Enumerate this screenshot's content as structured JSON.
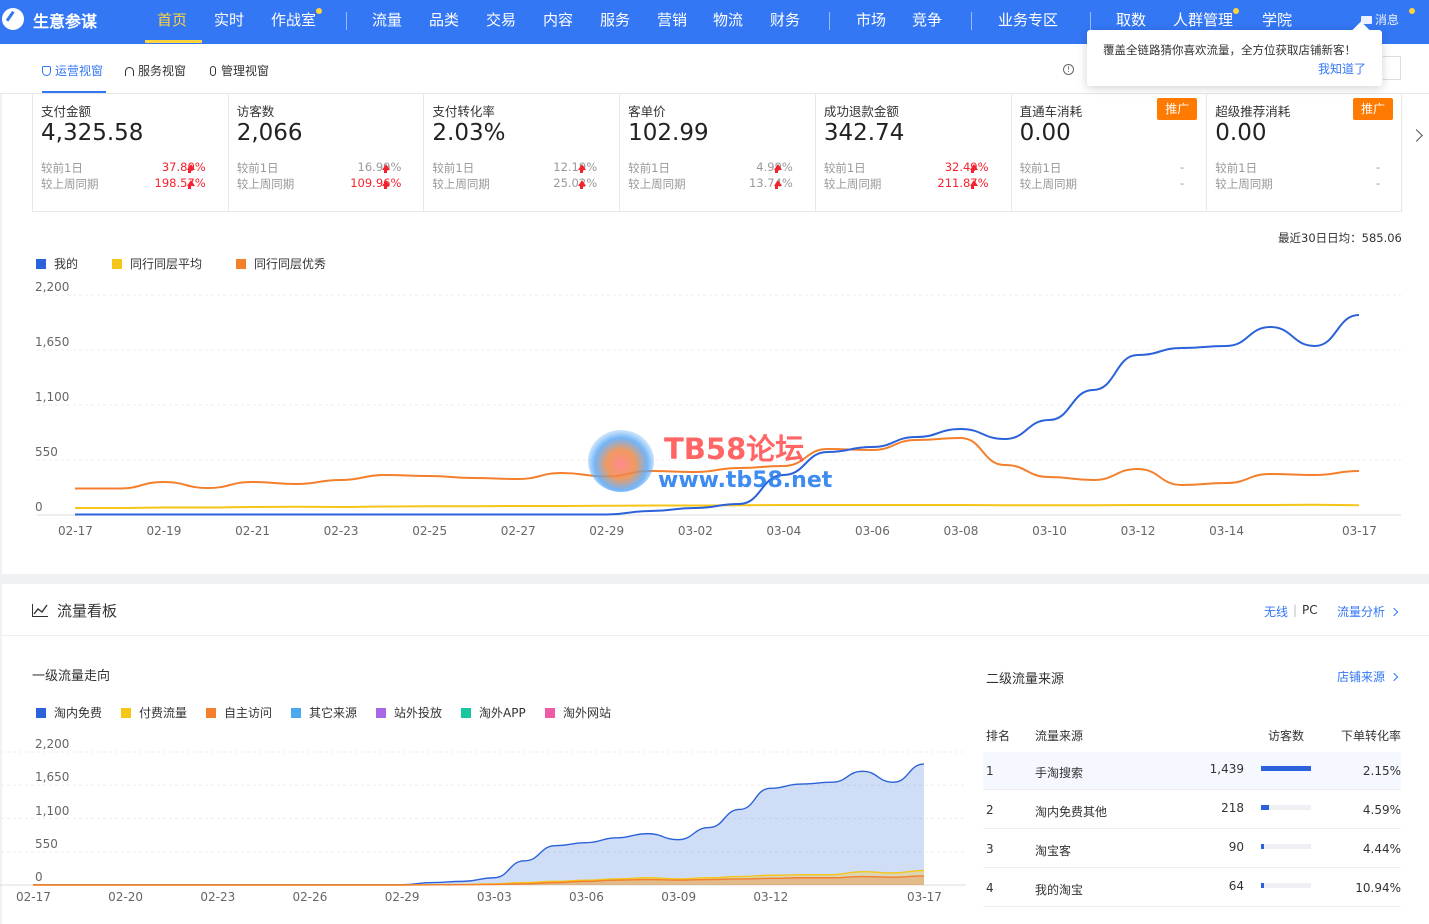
{
  "topnav": {
    "brand": "生意参谋",
    "items": [
      "首页",
      "实时",
      "作战室",
      "流量",
      "品类",
      "交易",
      "内容",
      "服务",
      "营销",
      "物流",
      "财务",
      "市场",
      "竞争",
      "业务专区",
      "取数",
      "人群管理",
      "学院"
    ],
    "message": "消息",
    "accent": "#3477f5",
    "active_color": "#ffd33d"
  },
  "tooltip": {
    "text": "覆盖全链路猜你喜欢流量，全方位获取店铺新客！",
    "link": "我知道了"
  },
  "subtabs": [
    "运营视窗",
    "服务视窗",
    "管理视窗"
  ],
  "kpis": [
    {
      "label": "支付金额",
      "value": "4,325.58",
      "cmp1_label": "较前1日",
      "cmp1": "37.80%",
      "cmp2_label": "较上周同期",
      "cmp2": "198.57%",
      "color": "red"
    },
    {
      "label": "访客数",
      "value": "2,066",
      "cmp1_label": "较前1日",
      "cmp1": "16.99%",
      "cmp2_label": "较上周同期",
      "cmp2": "109.96%",
      "color": "mixed"
    },
    {
      "label": "支付转化率",
      "value": "2.03%",
      "cmp1_label": "较前1日",
      "cmp1": "12.19%",
      "cmp2_label": "较上周同期",
      "cmp2": "25.02%",
      "color": "gray"
    },
    {
      "label": "客单价",
      "value": "102.99",
      "cmp1_label": "较前1日",
      "cmp1": "4.99%",
      "cmp2_label": "较上周同期",
      "cmp2": "13.74%",
      "color": "gray"
    },
    {
      "label": "成功退款金额",
      "value": "342.74",
      "cmp1_label": "较前1日",
      "cmp1": "32.49%",
      "cmp2_label": "较上周同期",
      "cmp2": "211.87%",
      "color": "red"
    },
    {
      "label": "直通车消耗",
      "value": "0.00",
      "cmp1_label": "较前1日",
      "cmp1": "-",
      "cmp2_label": "较上周同期",
      "cmp2": "-",
      "color": "none",
      "promo": "推广"
    },
    {
      "label": "超级推荐消耗",
      "value": "0.00",
      "cmp1_label": "较前1日",
      "cmp1": "-",
      "cmp2_label": "较上周同期",
      "cmp2": "-",
      "color": "none",
      "promo": "推广"
    }
  ],
  "avg_note": "最近30日日均：585.06",
  "watermark": {
    "title": "TB58论坛",
    "url": "www.tb58.net"
  },
  "traffic": {
    "title": "流量看板",
    "right_links": {
      "wireless": "无线",
      "sep": "|",
      "pc": "PC",
      "analysis": "流量分析"
    },
    "primary_title": "一级流量走向",
    "secondary_title": "二级流量来源",
    "shop_source": "店铺来源",
    "table": {
      "headers": [
        "排名",
        "流量来源",
        "访客数",
        "下单转化率"
      ],
      "rows": [
        {
          "rank": "1",
          "source": "手淘搜索",
          "visitors": "1,439",
          "rate": "2.15%",
          "share": 1.0
        },
        {
          "rank": "2",
          "source": "淘内免费其他",
          "visitors": "218",
          "rate": "4.59%",
          "share": 0.15
        },
        {
          "rank": "3",
          "source": "淘宝客",
          "visitors": "90",
          "rate": "4.44%",
          "share": 0.06
        },
        {
          "rank": "4",
          "source": "我的淘宝",
          "visitors": "64",
          "rate": "10.94%",
          "share": 0.045
        }
      ]
    }
  },
  "chart_data": [
    {
      "type": "line",
      "x": [
        "02-17",
        "02-18",
        "02-19",
        "02-20",
        "02-21",
        "02-22",
        "02-23",
        "02-24",
        "02-25",
        "02-26",
        "02-27",
        "02-28",
        "02-29",
        "03-01",
        "03-02",
        "03-03",
        "03-04",
        "03-05",
        "03-06",
        "03-07",
        "03-08",
        "03-09",
        "03-10",
        "03-11",
        "03-12",
        "03-13",
        "03-14",
        "03-15",
        "03-16",
        "03-17"
      ],
      "x_tick_labels": [
        "02-17",
        "02-19",
        "02-21",
        "02-23",
        "02-25",
        "02-27",
        "02-29",
        "03-02",
        "03-04",
        "03-06",
        "03-08",
        "03-10",
        "03-12",
        "03-14",
        "03-17"
      ],
      "yticks": [
        "2,200",
        "1,650",
        "1,100",
        "550",
        "0"
      ],
      "ylim": [
        0,
        2200
      ],
      "grid": true,
      "legend": "top-left",
      "series": [
        {
          "name": "我的",
          "color": "#2b62d9",
          "values": [
            5,
            5,
            5,
            5,
            5,
            5,
            5,
            5,
            5,
            5,
            5,
            5,
            5,
            40,
            70,
            110,
            400,
            630,
            680,
            780,
            860,
            760,
            950,
            1250,
            1600,
            1670,
            1690,
            1880,
            1690,
            2000
          ]
        },
        {
          "name": "同行同层平均",
          "color": "#f5c518",
          "values": [
            70,
            70,
            75,
            75,
            80,
            82,
            80,
            85,
            88,
            88,
            90,
            90,
            92,
            95,
            95,
            98,
            100,
            100,
            100,
            100,
            100,
            98,
            98,
            98,
            100,
            100,
            100,
            100,
            102,
            98
          ]
        },
        {
          "name": "同行同层优秀",
          "color": "#f47f2c",
          "values": [
            265,
            265,
            330,
            270,
            330,
            310,
            350,
            400,
            390,
            370,
            360,
            420,
            385,
            440,
            430,
            470,
            490,
            660,
            650,
            750,
            770,
            500,
            380,
            350,
            460,
            300,
            320,
            410,
            400,
            440
          ]
        }
      ]
    },
    {
      "type": "area",
      "x": [
        "02-17",
        "02-18",
        "02-19",
        "02-20",
        "02-21",
        "02-22",
        "02-23",
        "02-24",
        "02-25",
        "02-26",
        "02-27",
        "02-28",
        "02-29",
        "03-01",
        "03-02",
        "03-03",
        "03-04",
        "03-05",
        "03-06",
        "03-07",
        "03-08",
        "03-09",
        "03-10",
        "03-11",
        "03-12",
        "03-13",
        "03-14",
        "03-15",
        "03-16",
        "03-17"
      ],
      "x_tick_labels": [
        "02-17",
        "02-20",
        "02-23",
        "02-26",
        "02-29",
        "03-03",
        "03-06",
        "03-09",
        "03-12",
        "03-17"
      ],
      "yticks": [
        "2,200",
        "1,650",
        "1,100",
        "550",
        "0"
      ],
      "ylim": [
        0,
        2200
      ],
      "legend": "top-left",
      "series": [
        {
          "name": "淘内免费",
          "color": "#2b62d9",
          "values": [
            5,
            5,
            5,
            5,
            5,
            5,
            5,
            5,
            5,
            5,
            5,
            5,
            5,
            40,
            60,
            120,
            400,
            650,
            700,
            780,
            850,
            750,
            950,
            1250,
            1600,
            1670,
            1700,
            1880,
            1700,
            2000
          ]
        },
        {
          "name": "付费流量",
          "color": "#f5c518",
          "values": [
            0,
            0,
            0,
            0,
            0,
            0,
            0,
            0,
            0,
            0,
            0,
            0,
            0,
            5,
            10,
            20,
            40,
            60,
            80,
            100,
            120,
            100,
            120,
            140,
            160,
            170,
            170,
            220,
            200,
            240
          ]
        },
        {
          "name": "自主访问",
          "color": "#f47f2c",
          "values": [
            0,
            0,
            0,
            0,
            0,
            0,
            0,
            0,
            0,
            0,
            0,
            0,
            0,
            3,
            5,
            10,
            20,
            40,
            60,
            80,
            90,
            80,
            90,
            100,
            110,
            120,
            120,
            140,
            130,
            150
          ]
        },
        {
          "name": "其它来源",
          "color": "#4aa9ee",
          "values": []
        },
        {
          "name": "站外投放",
          "color": "#a868e6",
          "values": []
        },
        {
          "name": "淘外APP",
          "color": "#18c7a0",
          "values": []
        },
        {
          "name": "淘外网站",
          "color": "#ef5ba4",
          "values": []
        }
      ]
    }
  ]
}
